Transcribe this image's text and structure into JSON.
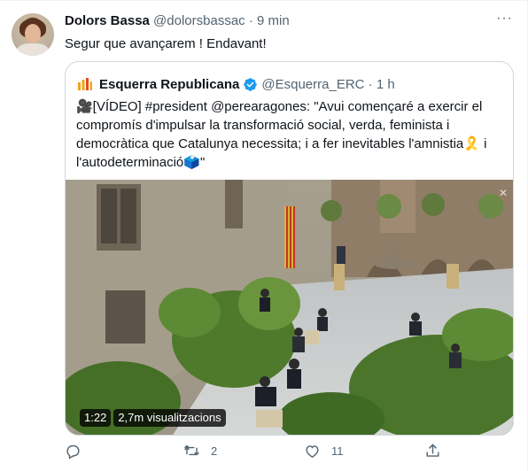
{
  "tweet": {
    "author_name": "Dolors Bassa",
    "author_meta": "@dolorsbassac · 9 min",
    "text": "Segur que avançarem ! Endavant!",
    "more_icon": "more-horizontal-icon"
  },
  "quote": {
    "author_name": "Esquerra Republicana",
    "author_meta": "@Esquerra_ERC · 1 h",
    "text": "🎥[VÍDEO] #president @perearagones: \"Avui començaré a exercir el compromís d'impulsar la transformació social, verda, feminista i democràtica que Catalunya necessita; i a fer inevitables l'amnistia🎗️ i l'autodeterminació🗳️\"",
    "video": {
      "duration": "1:22",
      "views": "2,7m visualitzacions"
    }
  },
  "actions": {
    "reply_count": "",
    "retweet_count": "2",
    "like_count": "11"
  },
  "colors": {
    "text": "#0f1419",
    "secondary": "#536471",
    "border": "#cfd9de",
    "verified": "#1d9bf0",
    "erc_logo": "#f2a51a"
  }
}
